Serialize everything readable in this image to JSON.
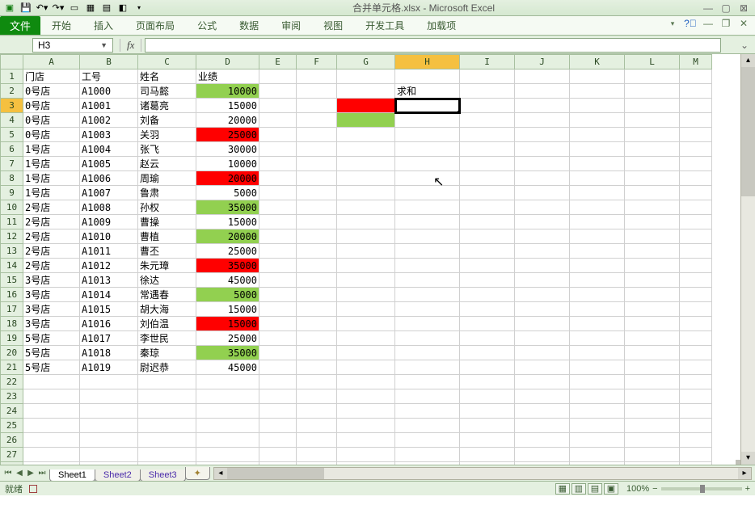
{
  "app": {
    "title": "合并单元格.xlsx - Microsoft Excel"
  },
  "tabs": {
    "file": "文件",
    "items": [
      "开始",
      "插入",
      "页面布局",
      "公式",
      "数据",
      "审阅",
      "视图",
      "开发工具",
      "加载项"
    ]
  },
  "namebox": {
    "ref": "H3",
    "fx_label": "fx"
  },
  "columns": [
    "A",
    "B",
    "C",
    "D",
    "E",
    "F",
    "G",
    "H",
    "I",
    "J",
    "K",
    "L",
    "M"
  ],
  "row_count": 28,
  "active": {
    "col": "H",
    "row": 3
  },
  "headers": {
    "A": "门店",
    "B": "工号",
    "C": "姓名",
    "D": "业绩"
  },
  "label_sum": "求和",
  "rows": [
    {
      "A": "0号店",
      "B": "A1000",
      "C": "司马懿",
      "D": 10000,
      "Dfill": "grn"
    },
    {
      "A": "0号店",
      "B": "A1001",
      "C": "诸葛亮",
      "D": 15000,
      "Dfill": ""
    },
    {
      "A": "0号店",
      "B": "A1002",
      "C": "刘备",
      "D": 20000,
      "Dfill": ""
    },
    {
      "A": "0号店",
      "B": "A1003",
      "C": "关羽",
      "D": 25000,
      "Dfill": "red"
    },
    {
      "A": "1号店",
      "B": "A1004",
      "C": "张飞",
      "D": 30000,
      "Dfill": ""
    },
    {
      "A": "1号店",
      "B": "A1005",
      "C": "赵云",
      "D": 10000,
      "Dfill": ""
    },
    {
      "A": "1号店",
      "B": "A1006",
      "C": "周瑜",
      "D": 20000,
      "Dfill": "red"
    },
    {
      "A": "1号店",
      "B": "A1007",
      "C": "鲁肃",
      "D": 5000,
      "Dfill": ""
    },
    {
      "A": "2号店",
      "B": "A1008",
      "C": "孙权",
      "D": 35000,
      "Dfill": "grn"
    },
    {
      "A": "2号店",
      "B": "A1009",
      "C": "曹操",
      "D": 15000,
      "Dfill": ""
    },
    {
      "A": "2号店",
      "B": "A1010",
      "C": "曹植",
      "D": 20000,
      "Dfill": "grn"
    },
    {
      "A": "2号店",
      "B": "A1011",
      "C": "曹丕",
      "D": 25000,
      "Dfill": ""
    },
    {
      "A": "2号店",
      "B": "A1012",
      "C": "朱元璋",
      "D": 35000,
      "Dfill": "red"
    },
    {
      "A": "3号店",
      "B": "A1013",
      "C": "徐达",
      "D": 45000,
      "Dfill": ""
    },
    {
      "A": "3号店",
      "B": "A1014",
      "C": "常遇春",
      "D": 5000,
      "Dfill": "grn"
    },
    {
      "A": "3号店",
      "B": "A1015",
      "C": "胡大海",
      "D": 15000,
      "Dfill": ""
    },
    {
      "A": "3号店",
      "B": "A1016",
      "C": "刘伯温",
      "D": 15000,
      "Dfill": "red"
    },
    {
      "A": "5号店",
      "B": "A1017",
      "C": "李世民",
      "D": 25000,
      "Dfill": ""
    },
    {
      "A": "5号店",
      "B": "A1018",
      "C": "秦琼",
      "D": 35000,
      "Dfill": "grn"
    },
    {
      "A": "5号店",
      "B": "A1019",
      "C": "尉迟恭",
      "D": 45000,
      "Dfill": ""
    }
  ],
  "extra_cells": {
    "G3": {
      "fill": "red",
      "val": ""
    },
    "G4": {
      "fill": "grn",
      "val": ""
    },
    "H2": {
      "fill": "",
      "val": "求和"
    }
  },
  "sheets": {
    "active": "Sheet1",
    "items": [
      "Sheet1",
      "Sheet2",
      "Sheet3"
    ]
  },
  "status": {
    "ready": "就绪",
    "zoom": "100%"
  },
  "chart_data": {
    "type": "table",
    "title": "业绩",
    "columns": [
      "门店",
      "工号",
      "姓名",
      "业绩"
    ],
    "rows": [
      [
        "0号店",
        "A1000",
        "司马懿",
        10000
      ],
      [
        "0号店",
        "A1001",
        "诸葛亮",
        15000
      ],
      [
        "0号店",
        "A1002",
        "刘备",
        20000
      ],
      [
        "0号店",
        "A1003",
        "关羽",
        25000
      ],
      [
        "1号店",
        "A1004",
        "张飞",
        30000
      ],
      [
        "1号店",
        "A1005",
        "赵云",
        10000
      ],
      [
        "1号店",
        "A1006",
        "周瑜",
        20000
      ],
      [
        "1号店",
        "A1007",
        "鲁肃",
        5000
      ],
      [
        "2号店",
        "A1008",
        "孙权",
        35000
      ],
      [
        "2号店",
        "A1009",
        "曹操",
        15000
      ],
      [
        "2号店",
        "A1010",
        "曹植",
        20000
      ],
      [
        "2号店",
        "A1011",
        "曹丕",
        25000
      ],
      [
        "2号店",
        "A1012",
        "朱元璋",
        35000
      ],
      [
        "3号店",
        "A1013",
        "徐达",
        45000
      ],
      [
        "3号店",
        "A1014",
        "常遇春",
        5000
      ],
      [
        "3号店",
        "A1015",
        "胡大海",
        15000
      ],
      [
        "3号店",
        "A1016",
        "刘伯温",
        15000
      ],
      [
        "5号店",
        "A1017",
        "李世民",
        25000
      ],
      [
        "5号店",
        "A1018",
        "秦琼",
        35000
      ],
      [
        "5号店",
        "A1019",
        "尉迟恭",
        45000
      ]
    ]
  }
}
